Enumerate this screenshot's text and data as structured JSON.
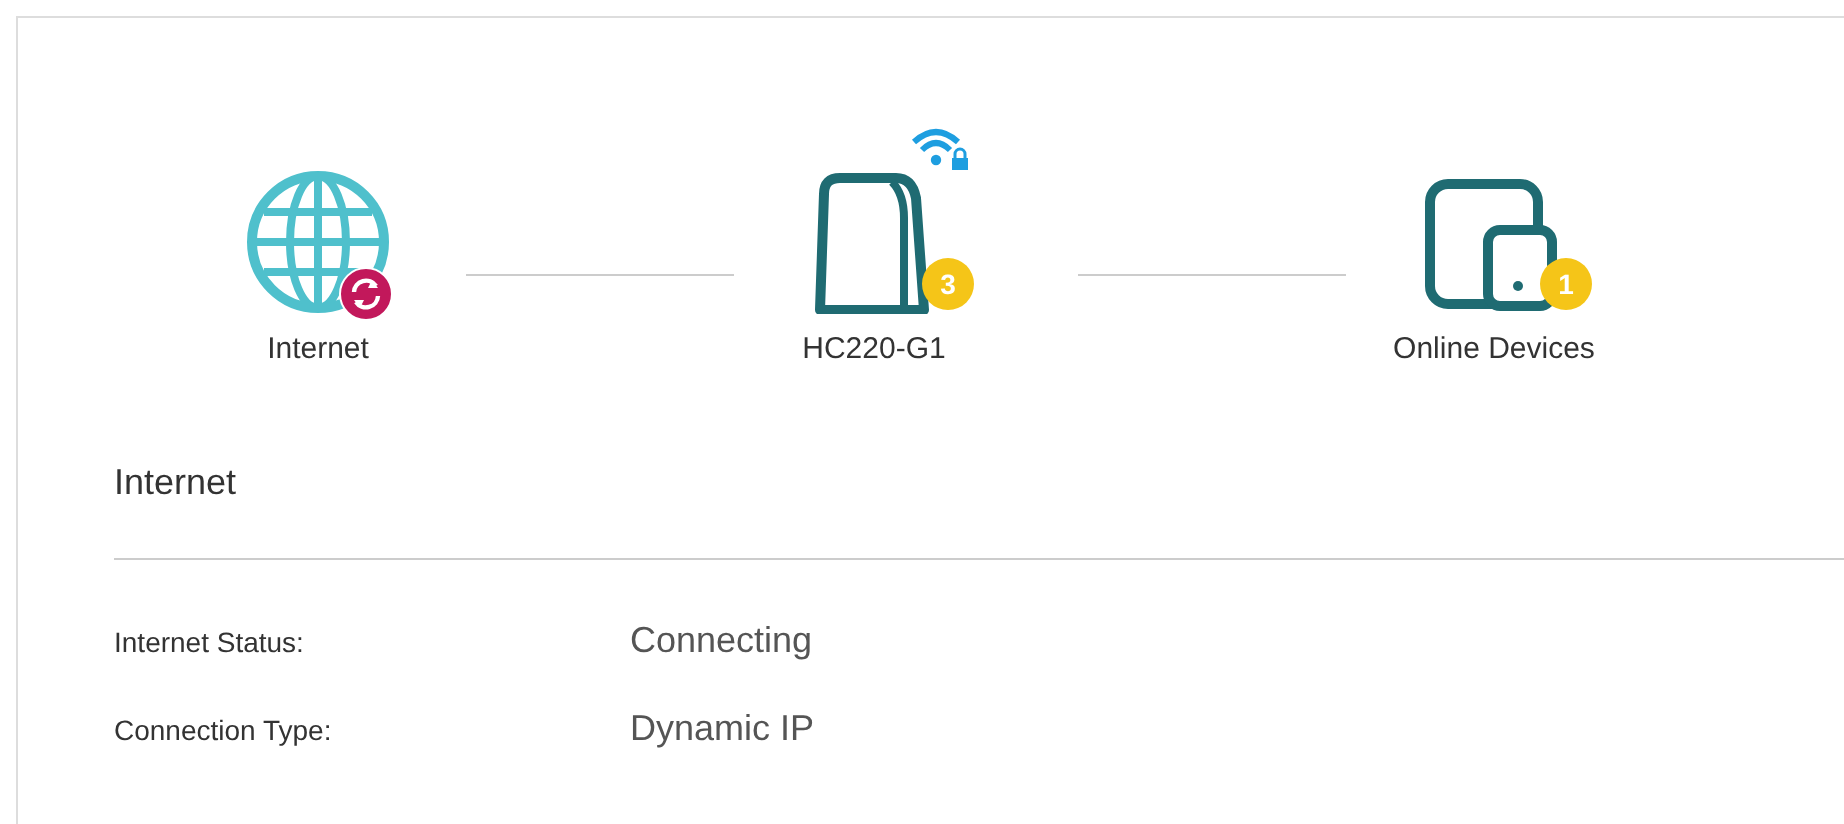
{
  "topology": {
    "nodes": [
      {
        "kind": "internet",
        "label": "Internet",
        "badge": {
          "kind": "sync"
        }
      },
      {
        "kind": "router",
        "label": "HC220-G1",
        "wifi_locked": true,
        "badge": {
          "kind": "count",
          "text": "3"
        }
      },
      {
        "kind": "devices",
        "label": "Online Devices",
        "badge": {
          "kind": "count",
          "text": "1"
        }
      }
    ]
  },
  "section": {
    "title": "Internet",
    "rows": [
      {
        "label": "Internet Status:",
        "value": "Connecting"
      },
      {
        "label": "Connection Type:",
        "value": "Dynamic IP"
      }
    ]
  }
}
